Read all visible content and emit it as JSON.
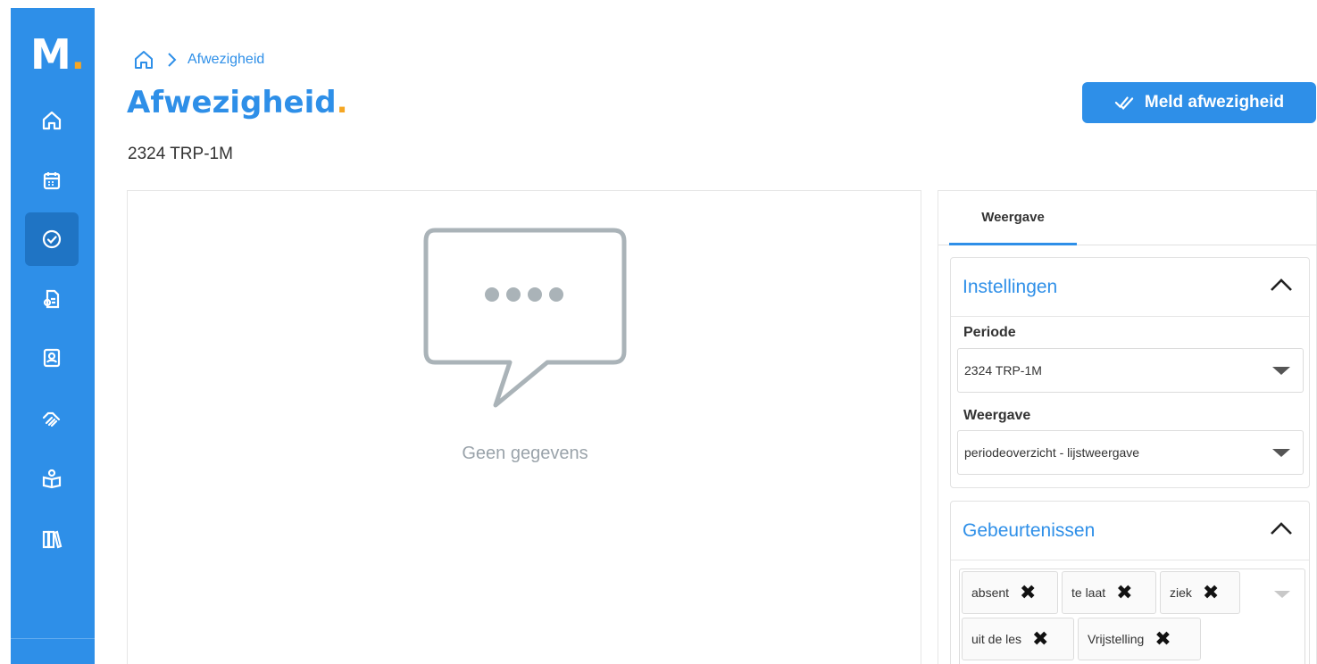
{
  "app": {
    "logo_letter": "M",
    "logo_dot": ".",
    "accent_color": "#2e8fe8",
    "dot_color": "#f5a623"
  },
  "sidebar": {
    "items": [
      {
        "icon": "home-icon"
      },
      {
        "icon": "calendar-icon"
      },
      {
        "icon": "check-circle-icon",
        "active": true
      },
      {
        "icon": "document-icon"
      },
      {
        "icon": "contact-card-icon"
      },
      {
        "icon": "handshake-icon"
      },
      {
        "icon": "study-book-icon"
      },
      {
        "icon": "library-icon"
      }
    ]
  },
  "breadcrumb": {
    "home_icon": "home-icon",
    "separator_icon": "chevron-right-icon",
    "current": "Afwezigheid"
  },
  "header": {
    "title": "Afwezigheid",
    "title_dot": ".",
    "subtitle": "2324 TRP-1M",
    "primary_button_label": "Meld afwezigheid",
    "primary_button_icon": "double-check-icon"
  },
  "main": {
    "empty_icon": "speech-bubble-icon",
    "empty_text": "Geen gegevens"
  },
  "right_panel": {
    "tabs": [
      {
        "label": "Weergave",
        "active": true
      }
    ],
    "settings": {
      "title": "Instellingen",
      "fields": {
        "period_label": "Periode",
        "period_value": "2324 TRP-1M",
        "view_label": "Weergave",
        "view_value": "periodeoverzicht - lijstweergave"
      }
    },
    "events": {
      "title": "Gebeurtenissen",
      "chips": [
        "absent",
        "te laat",
        "ziek",
        "uit de les",
        "Vrijstelling"
      ]
    }
  }
}
